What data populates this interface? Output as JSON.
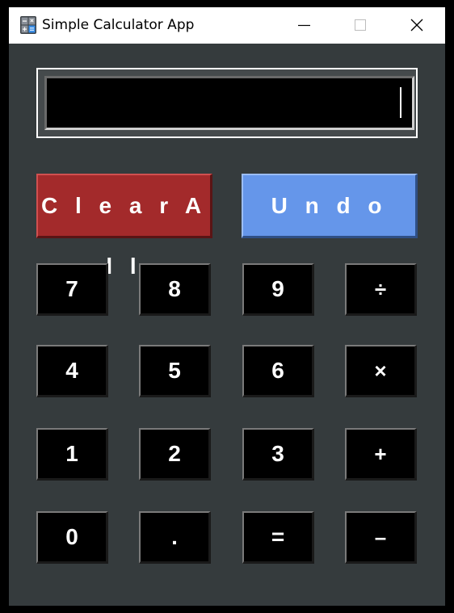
{
  "window": {
    "title": "Simple Calculator App",
    "icon": "calculator-icon",
    "controls": {
      "minimize": "minimize-icon",
      "maximize": "maximize-icon",
      "close": "close-icon"
    }
  },
  "display": {
    "value": ""
  },
  "actions": {
    "clear_label": "C l e a r   A l l",
    "undo_label": "U n d o"
  },
  "keypad": [
    [
      "7",
      "8",
      "9",
      "÷"
    ],
    [
      "4",
      "5",
      "6",
      "×"
    ],
    [
      "1",
      "2",
      "3",
      "+"
    ],
    [
      "0",
      ".",
      "=",
      "–"
    ]
  ],
  "colors": {
    "background": "#353b3d",
    "clear": "#a32a2b",
    "undo": "#6596ea",
    "key": "#000000",
    "text": "#ffffff"
  }
}
